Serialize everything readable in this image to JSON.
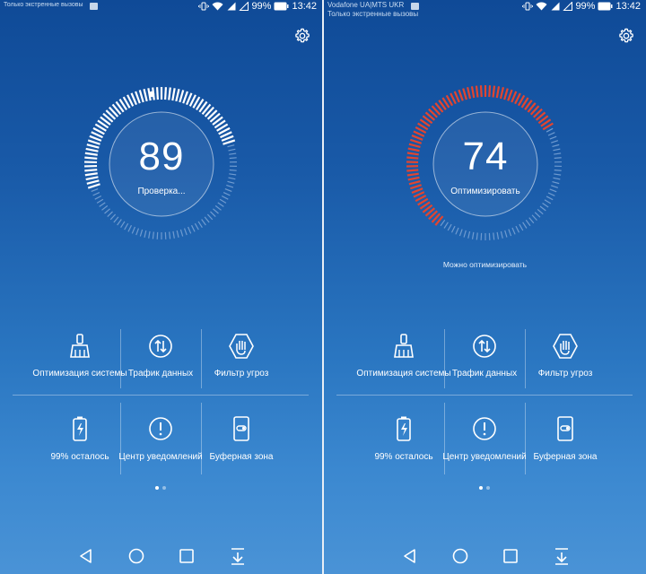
{
  "screens": [
    {
      "status": {
        "carrier_lines": [
          "Только экстренные вызовы"
        ],
        "battery": "99%",
        "time": "13:42"
      },
      "score": "89",
      "label": "Проверка...",
      "hint": "",
      "tiles": [
        {
          "label": "Оптимизация системы",
          "icon": "broom-icon"
        },
        {
          "label": "Трафик данных",
          "icon": "data-traffic-icon"
        },
        {
          "label": "Фильтр угроз",
          "icon": "hand-block-icon"
        },
        {
          "label": "99% осталось",
          "icon": "battery-icon"
        },
        {
          "label": "Центр уведомлений",
          "icon": "alert-circle-icon"
        },
        {
          "label": "Буферная зона",
          "icon": "phone-toggle-icon"
        }
      ]
    },
    {
      "status": {
        "carrier_lines": [
          "Vodafone UA|MTS UKR",
          "Только экстренные вызовы"
        ],
        "battery": "99%",
        "time": "13:42"
      },
      "score": "74",
      "label": "Оптимизировать",
      "hint": "Можно оптимизировать",
      "tiles": [
        {
          "label": "Оптимизация системы",
          "icon": "broom-icon"
        },
        {
          "label": "Трафик данных",
          "icon": "data-traffic-icon"
        },
        {
          "label": "Фильтр угроз",
          "icon": "hand-block-icon"
        },
        {
          "label": "99% осталось",
          "icon": "battery-icon"
        },
        {
          "label": "Центр уведомлений",
          "icon": "alert-circle-icon"
        },
        {
          "label": "Буферная зона",
          "icon": "phone-toggle-icon"
        }
      ]
    }
  ],
  "colors": {
    "ring_white": "#ffffff",
    "ring_dim": "#6f9bd0",
    "ring_red": "#e2452f"
  }
}
